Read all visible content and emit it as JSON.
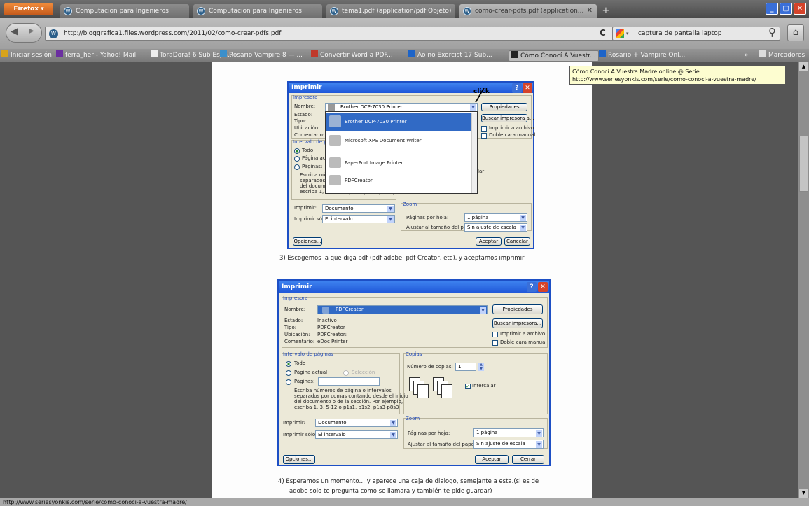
{
  "browser": {
    "menu_button": "Firefox ▾",
    "tabs": [
      {
        "label": "Computacion para Ingenieros"
      },
      {
        "label": "Computacion para Ingenieros"
      },
      {
        "label": "tema1.pdf (application/pdf Objeto)"
      },
      {
        "label": "como-crear-pdfs.pdf (application..."
      }
    ],
    "url": "http://bloggrafica1.files.wordpress.com/2011/02/como-crear-pdfs.pdf",
    "search_value": "captura de pantalla laptop",
    "bookmarks": [
      "Iniciar sesión",
      "ferra_her - Yahoo! Mail",
      "ToraDora! 6 Sub Espa...",
      "Rosario Vampire 8 — ...",
      "Convertir Word a PDF...",
      "Ao no Exorcist 17 Sub...",
      "Cómo Conocí A Vuestr...",
      "Rosario + Vampire Onl..."
    ],
    "bookmarks_menu": "Marcadores",
    "tooltip_title": "Cómo Conocí A Vuestra Madre online @ Serie",
    "tooltip_url": "http://www.seriesyonkis.com/serie/como-conoci-a-vuestra-madre/",
    "status_text": "http://www.seriesyonkis.com/serie/como-conoci-a-vuestra-madre/"
  },
  "document": {
    "dialog1": {
      "title": "Imprimir",
      "group_printer": "Impresora",
      "name_label": "Nombre:",
      "status_label": "Estado:",
      "type_label": "Tipo:",
      "location_label": "Ubicación:",
      "comment_label": "Comentario:",
      "selected_printer": "Brother DCP-7030 Printer",
      "properties_btn": "Propiedades",
      "find_printer_btn": "Buscar impresora a...",
      "print_to_file": "Imprimir a archivo",
      "duplex": "Doble cara manual",
      "dropdown_items": [
        "Brother DCP-7030 Printer",
        "Microsoft XPS Document Writer",
        "PaperPort Image Printer",
        "PDFCreator"
      ],
      "click_annotation": "click",
      "group_range": "Intervalo de pá",
      "all_label": "Todo",
      "current_page_label": "Página act",
      "pages_label": "Páginas:",
      "hint_lines": [
        "Escriba nú",
        "separados",
        "del docum",
        "escriba 1, 3, 5-12 o p1s1, p1s2, p1s3-p8s3"
      ],
      "intercalar_partial": "lar",
      "print_label": "Imprimir:",
      "print_value": "Documento",
      "print_only_label": "Imprimir sólo:",
      "print_only_value": "El intervalo",
      "zoom_label": "Zoom",
      "pages_per_sheet_label": "Páginas por hoja:",
      "pages_per_sheet_value": "1 página",
      "scale_label": "Ajustar al tamaño del papel:",
      "scale_value": "Sin ajuste de escala",
      "options_btn": "Opciones...",
      "accept_btn": "Aceptar",
      "cancel_btn": "Cancelar"
    },
    "step3_text": "3)  Escogemos la que diga pdf (pdf adobe, pdf Creator, etc), y aceptamos imprimir",
    "dialog2": {
      "title": "Imprimir",
      "group_printer": "Impresora",
      "name_label": "Nombre:",
      "selected_printer": "PDFCreator",
      "status_label": "Estado:",
      "status_value": "Inactivo",
      "type_label": "Tipo:",
      "type_value": "PDFCreator",
      "location_label": "Ubicación:",
      "location_value": "PDFCreator:",
      "comment_label": "Comentario:",
      "comment_value": "eDoc Printer",
      "properties_btn": "Propiedades",
      "find_printer_btn": "Buscar impresora...",
      "print_to_file": "Imprimir a archivo",
      "duplex": "Doble cara manual",
      "group_range": "Intervalo de páginas",
      "all_label": "Todo",
      "current_page_label": "Página actual",
      "selection_label": "Selección",
      "pages_label": "Páginas:",
      "hint_lines": [
        "Escriba números de página o intervalos",
        "separados por comas contando desde el inicio",
        "del documento o de la sección. Por ejemplo,",
        "escriba 1, 3, 5-12 o p1s1, p1s2, p1s3-p8s3"
      ],
      "group_copies": "Copias",
      "copies_label": "Número de copias:",
      "copies_value": "1",
      "collate_label": "Intercalar",
      "print_label": "Imprimir:",
      "print_value": "Documento",
      "print_only_label": "Imprimir sólo:",
      "print_only_value": "El intervalo",
      "zoom_label": "Zoom",
      "pages_per_sheet_label": "Páginas por hoja:",
      "pages_per_sheet_value": "1 página",
      "scale_label": "Ajustar al tamaño del papel:",
      "scale_value": "Sin ajuste de escala",
      "options_btn": "Opciones...",
      "accept_btn": "Aceptar",
      "close_btn": "Cerrar"
    },
    "step4_line1": "4)   Esperamos un momento…  y aparece una caja de dialogo, semejante a esta.(si es de",
    "step4_line2": "adobe solo te pregunta como se llamara y también te pide guardar)"
  }
}
